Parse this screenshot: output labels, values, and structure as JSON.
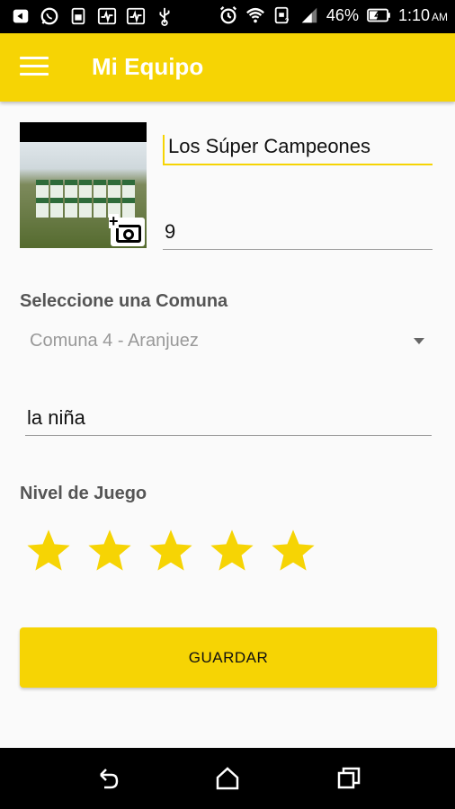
{
  "status_bar": {
    "battery": "46%",
    "time": "1:10",
    "ampm": "AM",
    "icons": [
      "back-notification-icon",
      "whatsapp-icon",
      "sim-icon",
      "pulse-icon",
      "pulse-icon",
      "usb-icon",
      "alarm-icon",
      "wifi-icon",
      "data-icon",
      "signal-icon",
      "battery-icon"
    ]
  },
  "app_bar": {
    "title": "Mi Equipo",
    "menu_icon": "hamburger-menu-icon",
    "color": "#f6d404"
  },
  "team": {
    "name": "Los Súper Campeones",
    "players": "9",
    "photo_badge_icon": "add-photo-camera-icon"
  },
  "comuna": {
    "label": "Seleccione una Comuna",
    "selected": "Comuna 4 - Aranjuez"
  },
  "neighborhood": {
    "value": "la niña"
  },
  "level": {
    "label": "Nivel de Juego",
    "rating": 5,
    "max": 5,
    "star_color": "#f6d404"
  },
  "actions": {
    "save_label": "GUARDAR"
  },
  "nav_bar": {
    "icons": [
      "back-icon",
      "home-icon",
      "recents-icon"
    ]
  }
}
